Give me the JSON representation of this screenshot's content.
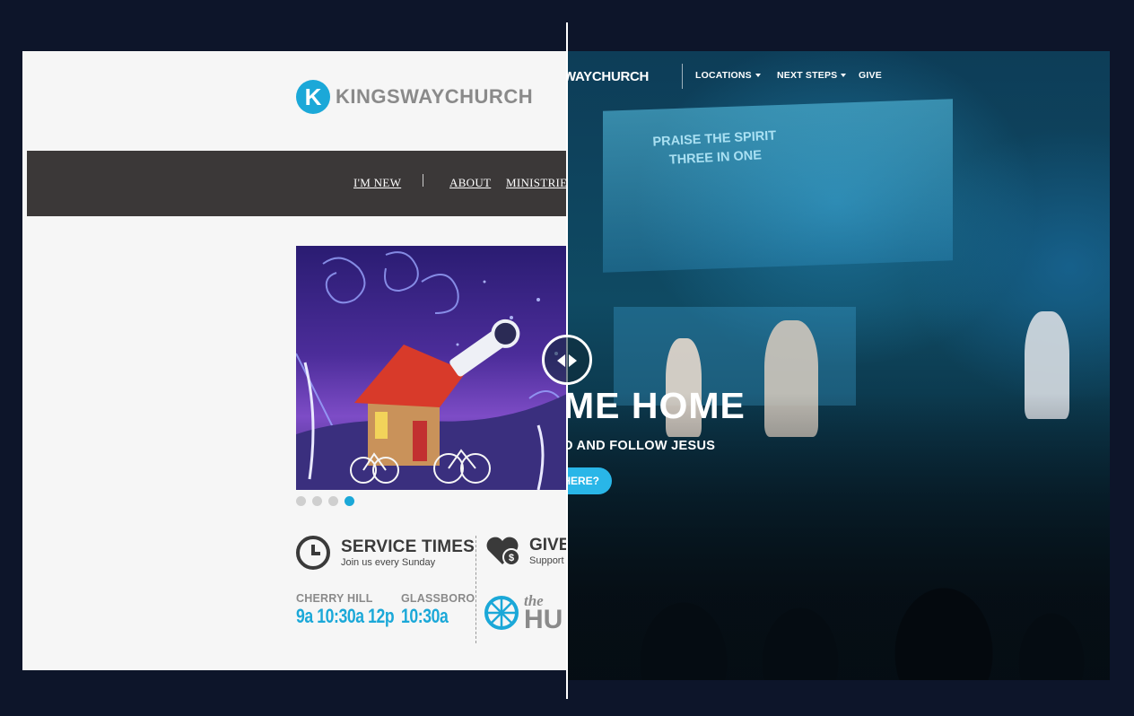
{
  "old_site": {
    "logo_letter": "K",
    "logo_text": "KINGSWAYCHURCH",
    "nav": [
      "I'M NEW",
      "ABOUT",
      "MINISTRIES"
    ],
    "slider": {
      "slides": 4,
      "active_index": 3
    },
    "service": {
      "title": "SERVICE TIMES",
      "subtitle": "Join us every Sunday",
      "locations": [
        {
          "name": "CHERRY HILL",
          "times": "9a  10:30a  12p"
        },
        {
          "name": "GLASSBORO",
          "times": "10:30a"
        }
      ]
    },
    "give": {
      "title": "GIVE",
      "subtitle": "Support"
    },
    "hub": {
      "the": "the",
      "word": "HU"
    }
  },
  "new_site": {
    "logo_text": "WAYCHURCH",
    "nav": [
      "LOCATIONS",
      "NEXT STEPS",
      "GIVE"
    ],
    "screen_lyrics": [
      "PRAISE THE SPIRIT",
      "THREE IN ONE"
    ],
    "headline": "ME HOME",
    "subline": "D AND FOLLOW JESUS",
    "cta": "HERE?"
  },
  "colors": {
    "accent": "#1ba8d8",
    "backdrop": "#0d152a",
    "old_nav": "#3b3838"
  },
  "icons": {
    "compare_handle": "left-right-arrows-icon"
  }
}
